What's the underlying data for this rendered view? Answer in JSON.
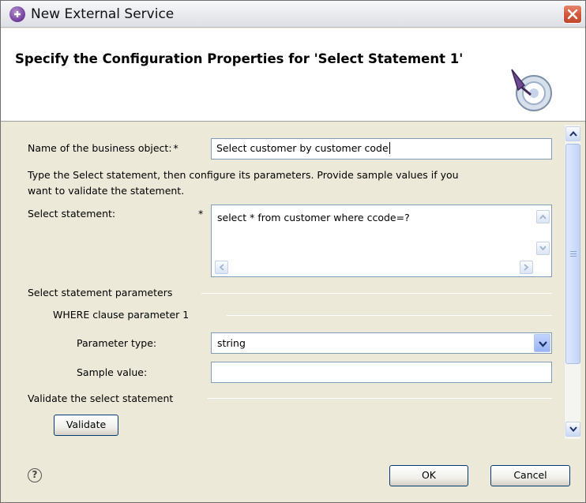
{
  "window": {
    "title": "New External Service",
    "banner_title": "Specify the Configuration Properties for 'Select Statement 1'"
  },
  "form": {
    "business_object_label": "Name of the business object:",
    "business_object_required": "*",
    "business_object_value": "Select customer by customer code",
    "instructions": [
      "Type the Select statement, then configure its parameters. Provide sample values if you",
      "want to validate the statement."
    ],
    "select_statement_label": "Select statement:",
    "select_statement_required": "*",
    "select_statement_value": "select * from customer where ccode=?",
    "parameters_section": "Select statement parameters",
    "where_clause_section": "WHERE clause parameter 1",
    "parameter_type_label": "Parameter type:",
    "parameter_type_value": "string",
    "sample_value_label": "Sample value:",
    "sample_value_value": "",
    "validate_section": "Validate the select statement",
    "validate_button": "Validate"
  },
  "footer": {
    "help_symbol": "?",
    "ok_button": "OK",
    "cancel_button": "Cancel"
  },
  "icons": {
    "app": "new-external-service-icon",
    "close": "close-icon",
    "wizard": "wizard-banner-icon",
    "help": "help-icon"
  },
  "colors": {
    "dialog_background": "#ece9d8",
    "banner_background": "#ffffff",
    "field_border": "#7f9db9",
    "close_button": "#d15a3c"
  }
}
